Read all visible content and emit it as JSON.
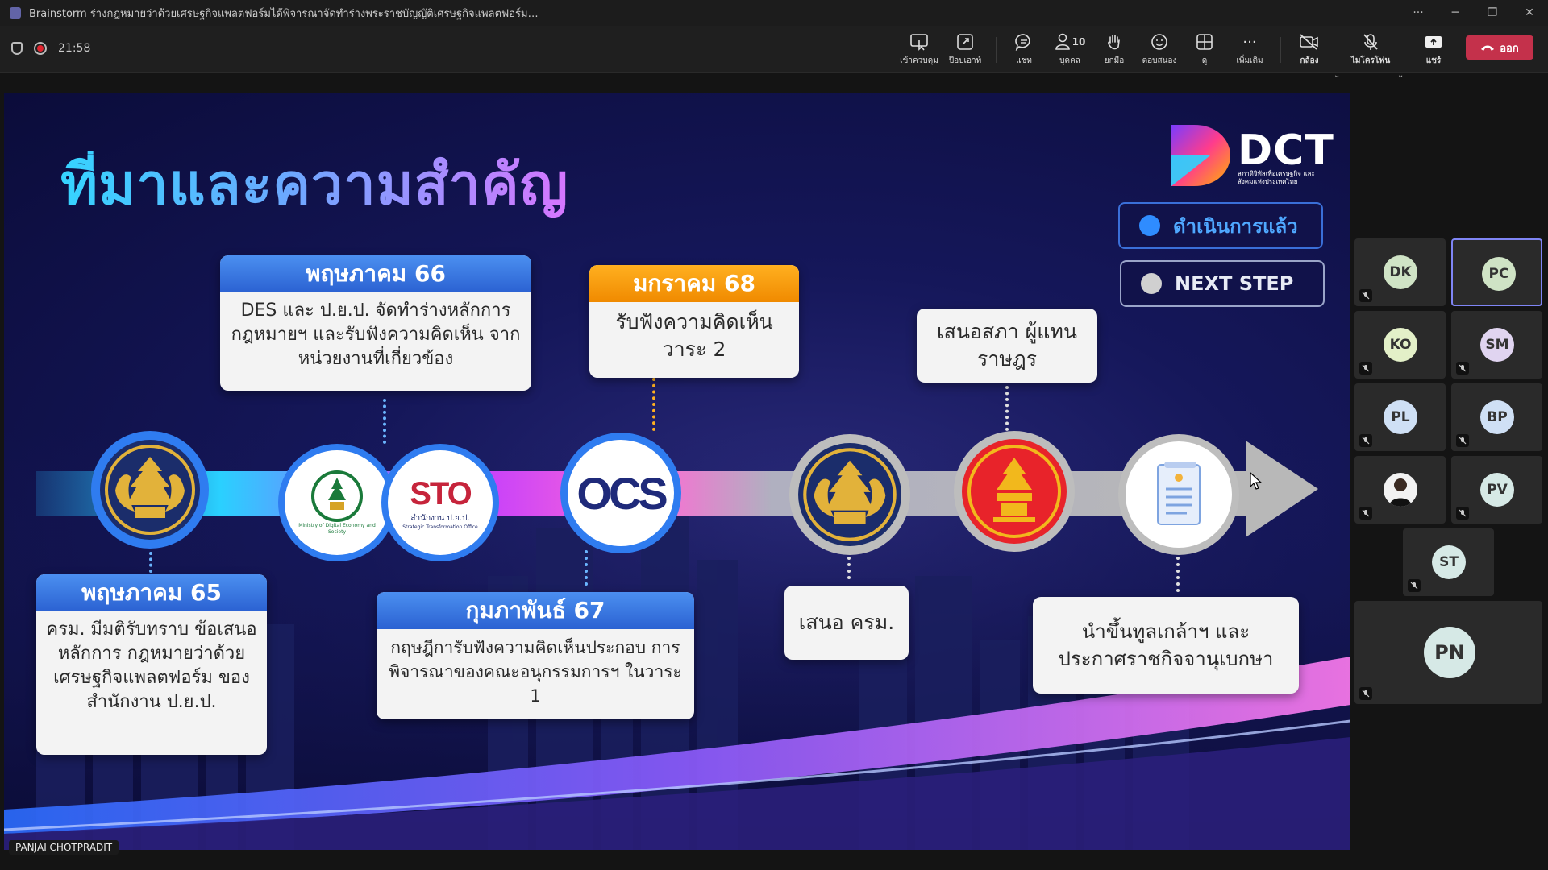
{
  "window": {
    "title": "Brainstorm ร่างกฎหมายว่าด้วยเศรษฐกิจแพลตฟอร์มได้พิจารณาจัดทำร่างพระราชบัญญัติเศรษฐกิจแพลตฟอร์มดิจิทัล พ.ศ. ...",
    "more": "···",
    "minimize": "─",
    "restore": "❐",
    "close": "✕"
  },
  "meeting": {
    "timer": "21:58"
  },
  "toolbar": {
    "items": [
      {
        "label": "เข้าควบคุม",
        "icon": "take-control-icon"
      },
      {
        "label": "ป๊อปเอาท์",
        "icon": "popout-icon"
      },
      {
        "label": "แชท",
        "icon": "chat-icon"
      },
      {
        "label": "บุคคล",
        "icon": "people-icon",
        "count": "10"
      },
      {
        "label": "ยกมือ",
        "icon": "raise-hand-icon"
      },
      {
        "label": "ตอบสนอง",
        "icon": "react-icon"
      },
      {
        "label": "ดู",
        "icon": "view-icon"
      },
      {
        "label": "เพิ่มเติม",
        "icon": "more-icon"
      },
      {
        "label": "กล้อง",
        "icon": "camera-off-icon"
      },
      {
        "label": "ไมโครโฟน",
        "icon": "mic-off-icon"
      },
      {
        "label": "แชร์",
        "icon": "share-icon"
      }
    ],
    "leave_label": "ออก"
  },
  "slide": {
    "title": "ที่มาและความสำคัญ",
    "logo_text": "DCT",
    "logo_sub": "สภาดิจิทัลเพื่อเศรษฐกิจ และสังคมแห่งประเทศไทย",
    "legend": {
      "done": "ดำเนินการแล้ว",
      "next": "NEXT STEP"
    },
    "milestones": {
      "may65": {
        "date": "พฤษภาคม 65",
        "text": "ครม. มีมติรับทราบ ข้อเสนอหลักการ กฎหมายว่าด้วย เศรษฐกิจแพลตฟอร์ม ของ สำนักงาน ป.ย.ป."
      },
      "may66": {
        "date": "พฤษภาคม 66",
        "text": "DES และ ป.ย.ป. จัดทำร่างหลักการ กฎหมายฯ และรับฟังความคิดเห็น จากหน่วยงานที่เกี่ยวข้อง"
      },
      "feb67": {
        "date": "กุมภาพันธ์ 67",
        "text": "กฤษฎีการับฟังความคิดเห็นประกอบ การพิจารณาของคณะอนุกรรมการฯ ในวาระ 1"
      },
      "jan68": {
        "date": "มกราคม 68",
        "text": "รับฟังความคิดเห็น วาระ 2"
      },
      "cabinet": {
        "text": "เสนอ ครม."
      },
      "parliament": {
        "text": "เสนอสภา ผู้แทนราษฎร"
      },
      "royal": {
        "text": "นำขึ้นทูลเกล้าฯ และ ประกาศราชกิจจานุเบกษา"
      }
    },
    "logos": {
      "mdes": "กระทรวงดิจิทัลเพื่อเศรษฐกิจและสังคม",
      "mdes_en": "Ministry of Digital Economy and Society",
      "sto": "STO",
      "sto_th": "สำนักงาน ป.ย.ป.",
      "sto_en": "Strategic Transformation Office",
      "ocs": "OCS"
    }
  },
  "presenter": {
    "name": "PANJAI CHOTPRADIT"
  },
  "participants": [
    {
      "initials": "DK",
      "color": "#cfe3c5",
      "muted": true
    },
    {
      "initials": "PC",
      "color": "#cfe3c5",
      "muted": false,
      "active": true
    },
    {
      "initials": "KO",
      "color": "#e3f0c8",
      "muted": true
    },
    {
      "initials": "SM",
      "color": "#e0d4f0",
      "muted": true
    },
    {
      "initials": "PL",
      "color": "#cfe0f5",
      "muted": true
    },
    {
      "initials": "BP",
      "color": "#cfe0f5",
      "muted": true
    },
    {
      "initials": "",
      "color": "#f2f2f2",
      "muted": true,
      "photo": true
    },
    {
      "initials": "PV",
      "color": "#d6e9e6",
      "muted": true
    },
    {
      "initials": "ST",
      "color": "#d6e9e6",
      "muted": true
    },
    {
      "initials": "PN",
      "color": "#d6e9e6",
      "muted": true
    }
  ]
}
